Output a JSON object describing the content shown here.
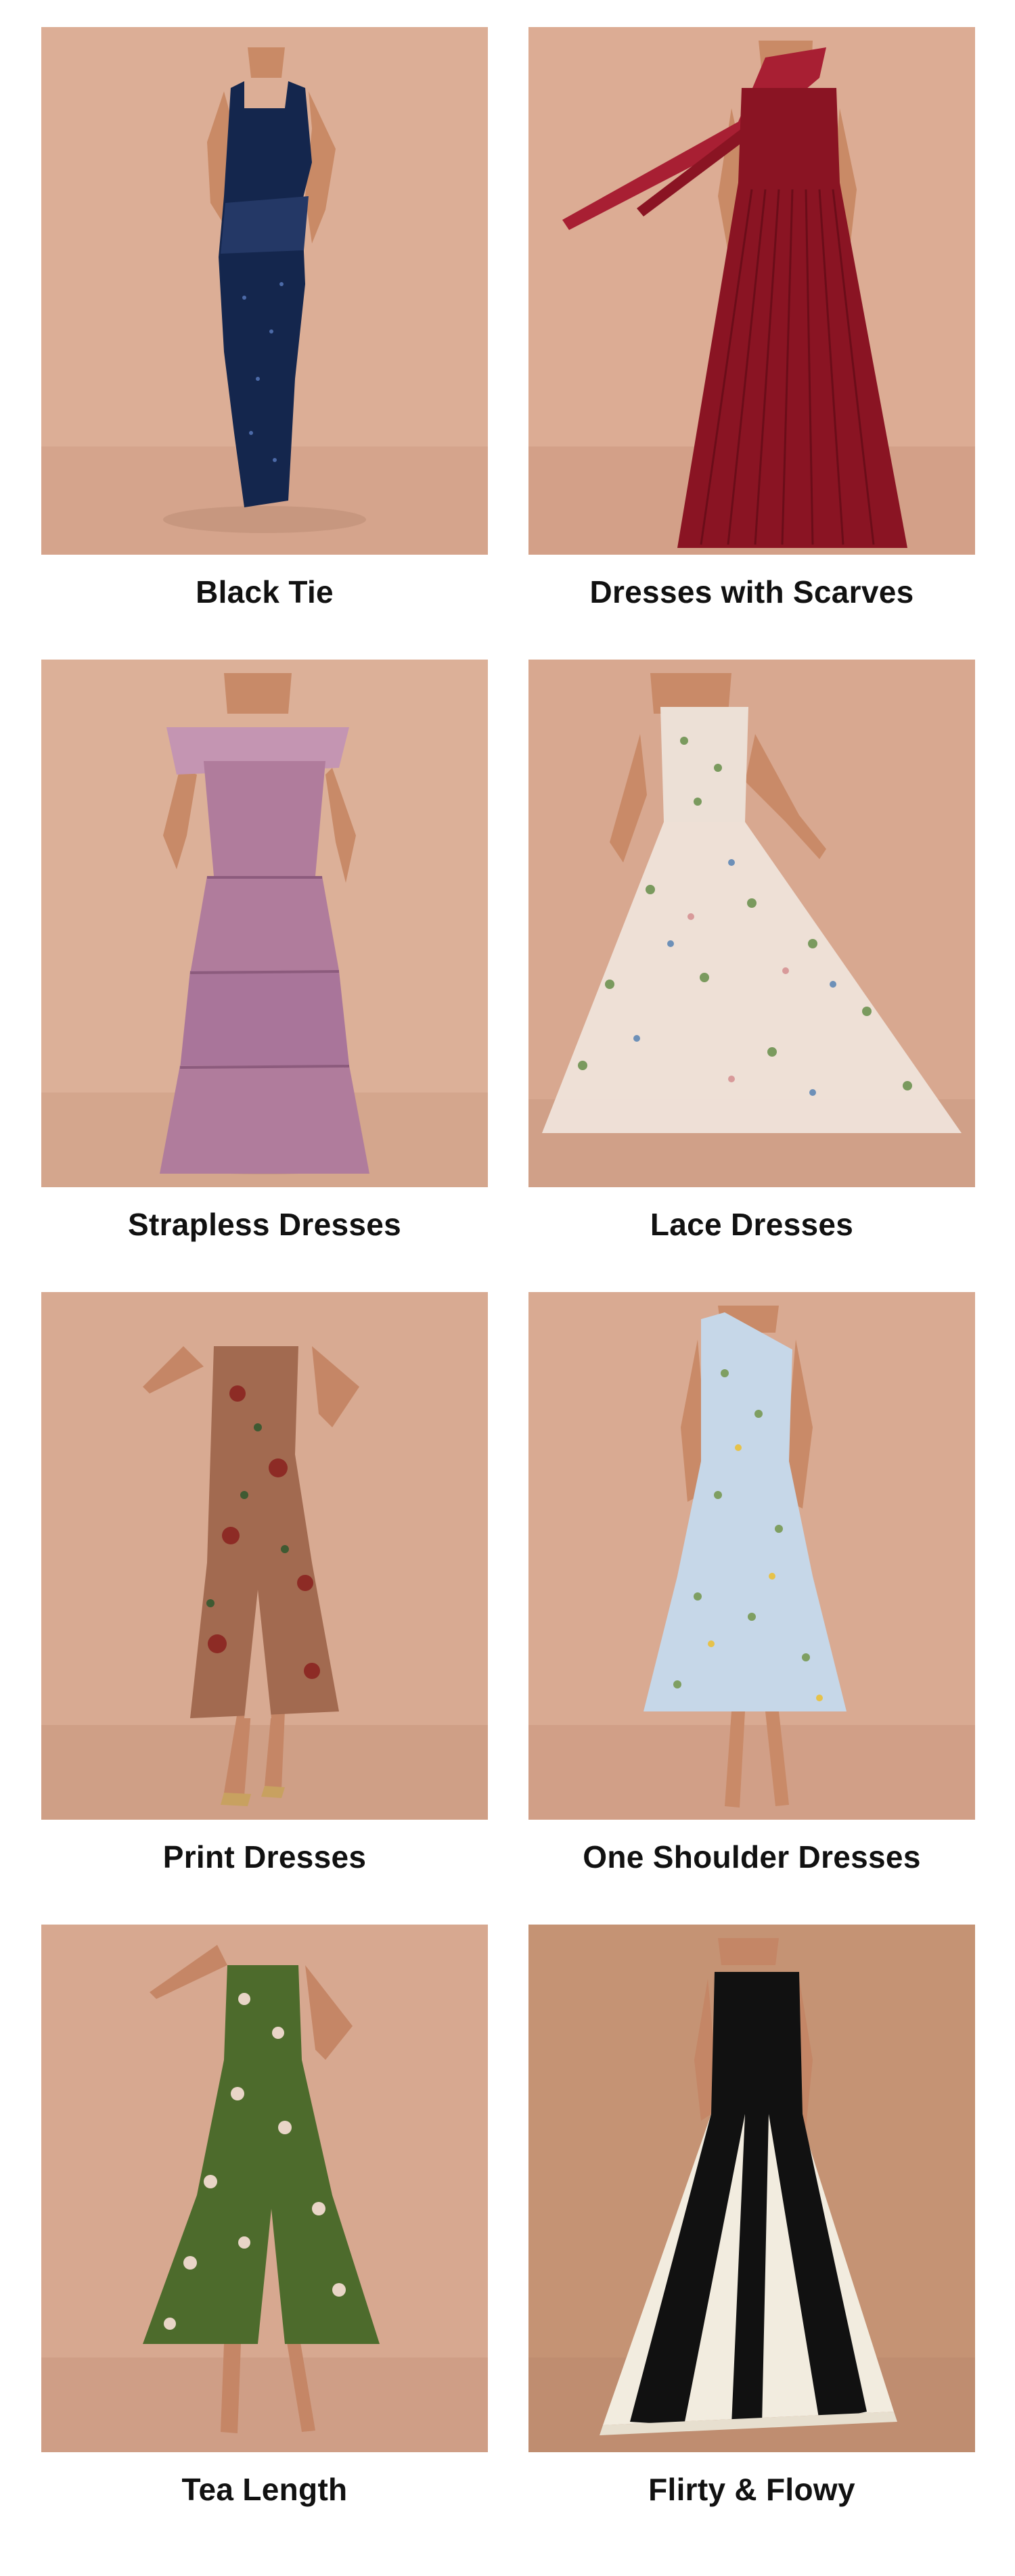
{
  "categories": [
    {
      "label": "Black Tie",
      "image": "navy-sequin-strap-gown",
      "colors": {
        "backdrop": "#dcae96",
        "floor": "#d5a48c",
        "dress": "#14264d",
        "accent": "#243866"
      }
    },
    {
      "label": "Dresses with Scarves",
      "image": "burgundy-pleated-scarf-gown",
      "colors": {
        "backdrop": "#dcac94",
        "floor": "#d3a088",
        "dress": "#8a1423",
        "accent": "#a81f33"
      }
    },
    {
      "label": "Strapless Dresses",
      "image": "mauve-tiered-ruffle-gown",
      "colors": {
        "backdrop": "#dcb098",
        "floor": "#d4a68d",
        "dress": "#b07c9c",
        "accent": "#c495b2"
      }
    },
    {
      "label": "Lace Dresses",
      "image": "floral-embroidered-tulle-ballgown",
      "colors": {
        "backdrop": "#d8a890",
        "floor": "#d0a088",
        "dress": "#ece0d6",
        "accent": "#7a9a5e"
      }
    },
    {
      "label": "Print Dresses",
      "image": "floral-print-slit-midi-dress",
      "colors": {
        "backdrop": "#d8aa92",
        "floor": "#cf9f86",
        "dress": "#a26a50",
        "accent": "#8d2b25"
      }
    },
    {
      "label": "One Shoulder Dresses",
      "image": "blue-floral-one-shoulder-midi",
      "colors": {
        "backdrop": "#d9aa92",
        "floor": "#d19f87",
        "dress": "#c6d7e8",
        "accent": "#7f9f62"
      }
    },
    {
      "label": "Tea Length",
      "image": "green-floral-ruffle-midi",
      "colors": {
        "backdrop": "#d7a890",
        "floor": "#cf9e86",
        "dress": "#4d6b2c",
        "accent": "#e9d5c7"
      }
    },
    {
      "label": "Flirty & Flowy",
      "image": "black-ivory-godet-gown",
      "colors": {
        "backdrop": "#c59374",
        "floor": "#bf8d70",
        "dress": "#111111",
        "accent": "#f2ecdf"
      }
    }
  ]
}
